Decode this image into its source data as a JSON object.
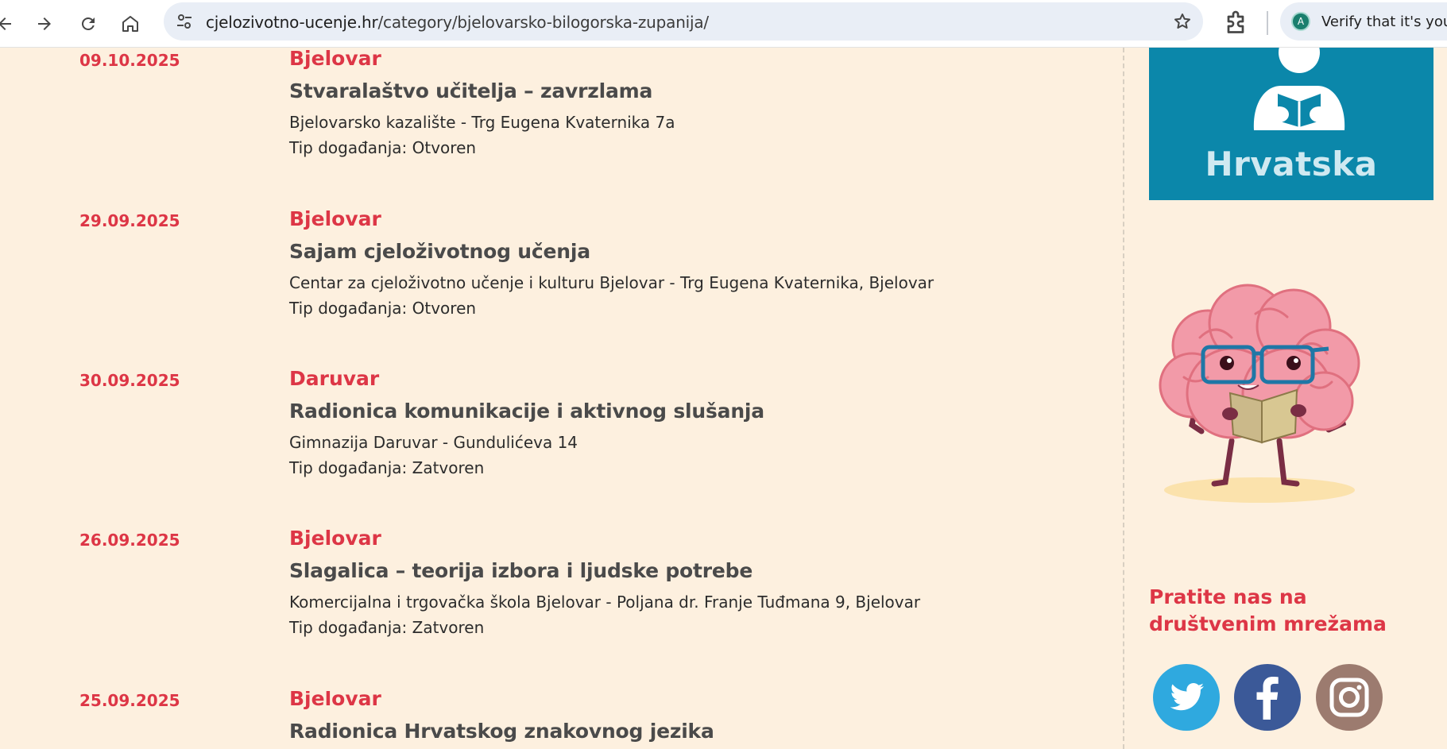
{
  "browser": {
    "url_domain": "cjelozivotno-ucenje.hr",
    "url_path": "/category/bjelovarsko-bilogorska-zupanija/",
    "profile_text": "Verify that it's you",
    "profile_initial": "A"
  },
  "events": [
    {
      "date": "09.10.2025",
      "city": "Bjelovar",
      "title": "Stvaralaštvo učitelja – zavrzlama",
      "location": "Bjelovarsko kazalište - Trg Eugena Kvaternika 7a",
      "type": "Tip događanja: Otvoren"
    },
    {
      "date": "29.09.2025",
      "city": "Bjelovar",
      "title": "Sajam cjeloživotnog učenja",
      "location": "Centar za cjeloživotno učenje i kulturu Bjelovar - Trg Eugena Kvaternika, Bjelovar",
      "type": "Tip događanja: Otvoren"
    },
    {
      "date": "30.09.2025",
      "city": "Daruvar",
      "title": "Radionica komunikacije i aktivnog slušanja",
      "location": "Gimnazija Daruvar - Gundulićeva 14",
      "type": "Tip događanja: Zatvoren"
    },
    {
      "date": "26.09.2025",
      "city": "Bjelovar",
      "title": "Slagalica – teorija izbora i ljudske potrebe",
      "location": "Komercijalna i trgovačka škola Bjelovar - Poljana dr. Franje Tuđmana 9, Bjelovar",
      "type": "Tip događanja: Zatvoren"
    },
    {
      "date": "25.09.2025",
      "city": "Bjelovar",
      "title": "Radionica Hrvatskog znakovnog jezika",
      "location": "",
      "type": ""
    }
  ],
  "sidebar": {
    "banner_text": "Hrvatska",
    "social_title": "Pratite nas na društvenim mrežama",
    "social_icons": [
      "twitter-icon",
      "facebook-icon",
      "instagram-icon"
    ]
  },
  "colors": {
    "accent": "#dd3646",
    "background": "#fdf0df",
    "banner": "#0b87aa",
    "twitter": "#2fa9df",
    "facebook": "#3b5998",
    "instagram": "#9c7b6f"
  }
}
